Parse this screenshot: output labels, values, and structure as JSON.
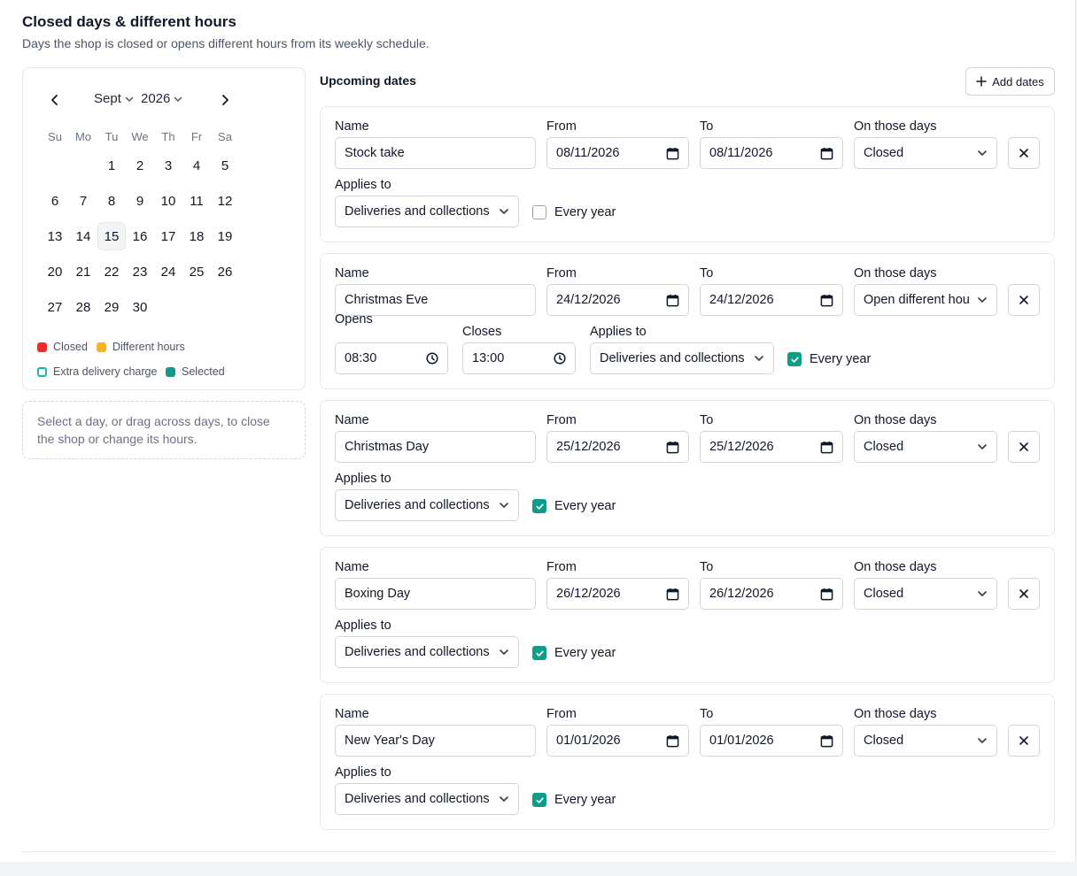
{
  "page": {
    "title": "Closed days & different hours",
    "subtitle": "Days the shop is closed or opens different hours from its weekly schedule."
  },
  "calendar": {
    "month": "Sept",
    "year": "2026",
    "weekdays": [
      "Su",
      "Mo",
      "Tu",
      "We",
      "Th",
      "Fr",
      "Sa"
    ],
    "weeks": [
      [
        "",
        "",
        "1",
        "2",
        "3",
        "4",
        "5"
      ],
      [
        "6",
        "7",
        "8",
        "9",
        "10",
        "11",
        "12"
      ],
      [
        "13",
        "14",
        "15",
        "16",
        "17",
        "18",
        "19"
      ],
      [
        "20",
        "21",
        "22",
        "23",
        "24",
        "25",
        "26"
      ],
      [
        "27",
        "28",
        "29",
        "30",
        "",
        "",
        ""
      ]
    ],
    "today": "15",
    "legend": {
      "closed": "Closed",
      "different": "Different hours",
      "extra": "Extra delivery charge",
      "selected": "Selected"
    },
    "colors": {
      "closed": "#ef2b2d",
      "different": "#fbb31c",
      "extra": "#14b8a6",
      "selected": "#0f9d8a"
    }
  },
  "hint": "Select a day, or drag across days, to close the shop or change its hours.",
  "upcoming": {
    "title": "Upcoming dates",
    "add_label": "Add dates"
  },
  "labels": {
    "name": "Name",
    "from": "From",
    "to": "To",
    "on_those_days": "On those days",
    "applies_to": "Applies to",
    "opens": "Opens",
    "closes": "Closes",
    "every_year": "Every year"
  },
  "entries": [
    {
      "name": "Stock take",
      "from": "08/11/2026",
      "to": "08/11/2026",
      "mode": "Closed",
      "applies": "Deliveries and collections",
      "every_year": false
    },
    {
      "name": "Christmas Eve",
      "from": "24/12/2026",
      "to": "24/12/2026",
      "mode": "Open different hou",
      "opens": "08:30",
      "closes": "13:00",
      "applies": "Deliveries and collections",
      "every_year": true
    },
    {
      "name": "Christmas Day",
      "from": "25/12/2026",
      "to": "25/12/2026",
      "mode": "Closed",
      "applies": "Deliveries and collections",
      "every_year": true
    },
    {
      "name": "Boxing Day",
      "from": "26/12/2026",
      "to": "26/12/2026",
      "mode": "Closed",
      "applies": "Deliveries and collections",
      "every_year": true
    },
    {
      "name": "New Year's Day",
      "from": "01/01/2026",
      "to": "01/01/2026",
      "mode": "Closed",
      "applies": "Deliveries and collections",
      "every_year": true
    }
  ]
}
